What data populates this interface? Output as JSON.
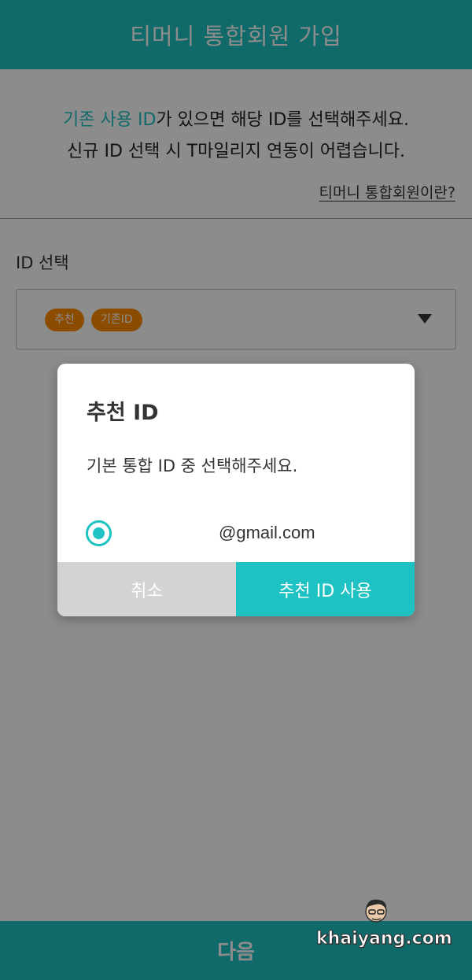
{
  "header": {
    "title": "티머니 통합회원 가입"
  },
  "notice": {
    "line1_highlight": "기존 사용 ID",
    "line1_rest": "가 있으면 해당 ID를 선택해주세요.",
    "line2": "신규 ID 선택 시 T마일리지 연동이 어렵습니다.",
    "link": "티머니 통합회원이란?"
  },
  "id_select": {
    "label": "ID 선택",
    "tags": [
      "추천",
      "기존ID"
    ]
  },
  "dialog": {
    "title": "추천 ID",
    "message": "기본 통합 ID 중 선택해주세요.",
    "option_label": "@gmail.com",
    "cancel_label": "취소",
    "confirm_label": "추천 ID 사용"
  },
  "footer": {
    "next_label": "다음"
  },
  "watermark": {
    "text": "khaiyang.com"
  },
  "colors": {
    "accent": "#1fc2c2",
    "tag": "#ff8a00",
    "cancel": "#d3d3d3"
  }
}
